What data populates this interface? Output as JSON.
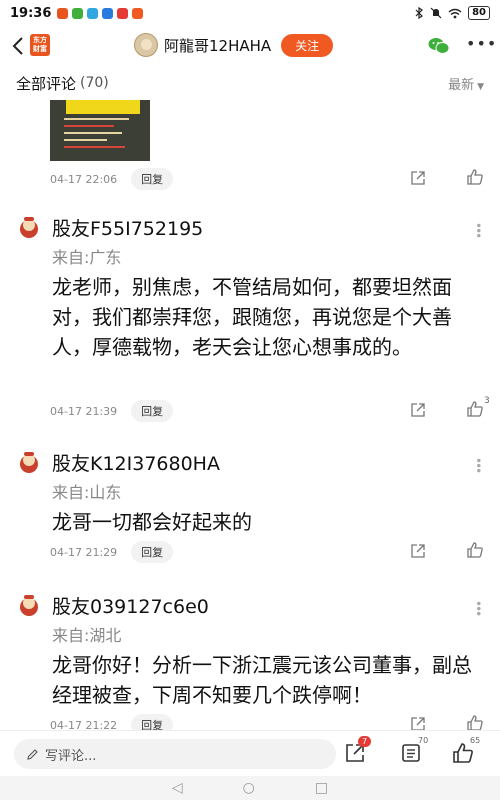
{
  "status_bar": {
    "time": "19:36",
    "battery": "80",
    "app_icon_colors": [
      "#e8541e",
      "#3eaf3b",
      "#2fa8e0",
      "#2a7be0",
      "#e53935",
      "#f05a22"
    ]
  },
  "header": {
    "logo_text": "东方财富",
    "author_name": "阿龍哥12HAHA",
    "follow_label": "关注"
  },
  "comments_header": {
    "title": "全部评论",
    "count": "(70)",
    "sort_label": "最新"
  },
  "comments": [
    {
      "time": "04-17 22:06",
      "reply_label": "回复",
      "likes": "",
      "has_image": true
    },
    {
      "user": "股友F55I752195",
      "location_label": "来自:",
      "location": "广东",
      "body": "龙老师，别焦虑，不管结局如何，都要坦然面对，我们都崇拜您，跟随您，再说您是个大善人，厚德载物，老天会让您心想事成的。",
      "time": "04-17 21:39",
      "reply_label": "回复",
      "likes": "3"
    },
    {
      "user": "股友K12I37680HA",
      "location_label": "来自:",
      "location": "山东",
      "body": "龙哥一切都会好起来的",
      "time": "04-17 21:29",
      "reply_label": "回复",
      "likes": ""
    },
    {
      "user": "股友039127c6e0",
      "location_label": "来自:",
      "location": "湖北",
      "body": "龙哥你好！分析一下浙江震元该公司董事，副总经理被查，下周不知要几个跌停啊！",
      "time": "04-17 21:22",
      "reply_label": "回复",
      "likes": ""
    }
  ],
  "bottom_bar": {
    "placeholder": "写评论...",
    "share_badge": "7",
    "comment_count": "70",
    "like_count": "65"
  },
  "colors": {
    "accent": "#f05a22",
    "badge_red": "#e53935",
    "wechat_green": "#3eaf3b"
  }
}
